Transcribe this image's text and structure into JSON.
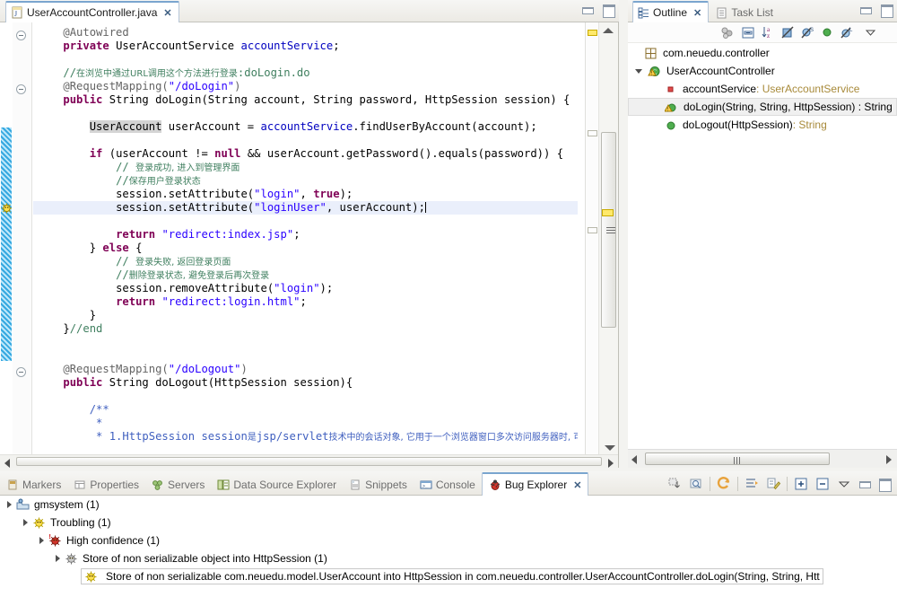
{
  "editor": {
    "tab": {
      "label": "UserAccountController.java",
      "close": "✕",
      "icon": "java-file-icon"
    },
    "window_buttons": {
      "minimize": "minimize-icon",
      "maximize": "maximize-icon"
    },
    "code_lines": [
      {
        "indent": 4,
        "tokens": [
          {
            "t": "@Autowired",
            "c": "ann"
          }
        ]
      },
      {
        "indent": 4,
        "tokens": [
          {
            "t": "private",
            "c": "kw"
          },
          {
            "t": " UserAccountService "
          },
          {
            "t": "accountService",
            "c": "fld"
          },
          {
            "t": ";"
          }
        ]
      },
      {
        "indent": 0,
        "tokens": []
      },
      {
        "indent": 4,
        "tokens": [
          {
            "t": "//",
            "c": "cmt"
          },
          {
            "t": "在浏览中通过URL调用这个方法进行登录",
            "c": "cmt cn"
          },
          {
            "t": ":doLogin.do",
            "c": "cmt"
          }
        ]
      },
      {
        "indent": 4,
        "tokens": [
          {
            "t": "@RequestMapping(",
            "c": "ann"
          },
          {
            "t": "\"/doLogin\"",
            "c": "str"
          },
          {
            "t": ")",
            "c": "ann"
          }
        ]
      },
      {
        "indent": 4,
        "tokens": [
          {
            "t": "public",
            "c": "kw"
          },
          {
            "t": " String doLogin(String account, String password, HttpSession session) {"
          }
        ]
      },
      {
        "indent": 0,
        "tokens": []
      },
      {
        "indent": 8,
        "tokens": [
          {
            "t": "UserAccount",
            "c": "sel-id"
          },
          {
            "t": " userAccount = "
          },
          {
            "t": "accountService",
            "c": "fld"
          },
          {
            "t": ".findUserByAccount(account);"
          }
        ]
      },
      {
        "indent": 0,
        "tokens": []
      },
      {
        "indent": 8,
        "tokens": [
          {
            "t": "if",
            "c": "kw"
          },
          {
            "t": " (userAccount != "
          },
          {
            "t": "null",
            "c": "kw"
          },
          {
            "t": " && userAccount.getPassword().equals(password)) {"
          }
        ]
      },
      {
        "indent": 12,
        "tokens": [
          {
            "t": "// ",
            "c": "cmt"
          },
          {
            "t": "登录成功, 进入到管理界面",
            "c": "cmt cn"
          }
        ]
      },
      {
        "indent": 12,
        "tokens": [
          {
            "t": "//",
            "c": "cmt"
          },
          {
            "t": "保存用户登录状态",
            "c": "cmt cn"
          }
        ]
      },
      {
        "indent": 12,
        "tokens": [
          {
            "t": "session.setAttribute("
          },
          {
            "t": "\"login\"",
            "c": "str"
          },
          {
            "t": ", "
          },
          {
            "t": "true",
            "c": "kw"
          },
          {
            "t": ");"
          }
        ]
      },
      {
        "indent": 12,
        "current": true,
        "tokens": [
          {
            "t": "session.setAttribute("
          },
          {
            "t": "\"loginUser\"",
            "c": "str"
          },
          {
            "t": ", userAccount);"
          },
          {
            "t": "",
            "caret": true
          }
        ]
      },
      {
        "indent": 0,
        "tokens": []
      },
      {
        "indent": 12,
        "tokens": [
          {
            "t": "return",
            "c": "kw"
          },
          {
            "t": " "
          },
          {
            "t": "\"redirect:index.jsp\"",
            "c": "str"
          },
          {
            "t": ";"
          }
        ]
      },
      {
        "indent": 8,
        "tokens": [
          {
            "t": "} "
          },
          {
            "t": "else",
            "c": "kw"
          },
          {
            "t": " {"
          }
        ]
      },
      {
        "indent": 12,
        "tokens": [
          {
            "t": "// ",
            "c": "cmt"
          },
          {
            "t": "登录失败, 返回登录页面",
            "c": "cmt cn"
          }
        ]
      },
      {
        "indent": 12,
        "tokens": [
          {
            "t": "//",
            "c": "cmt"
          },
          {
            "t": "删除登录状态, 避免登录后再次登录",
            "c": "cmt cn"
          }
        ]
      },
      {
        "indent": 12,
        "tokens": [
          {
            "t": "session.removeAttribute("
          },
          {
            "t": "\"login\"",
            "c": "str"
          },
          {
            "t": ");"
          }
        ]
      },
      {
        "indent": 12,
        "tokens": [
          {
            "t": "return",
            "c": "kw"
          },
          {
            "t": " "
          },
          {
            "t": "\"redirect:login.html\"",
            "c": "str"
          },
          {
            "t": ";"
          }
        ]
      },
      {
        "indent": 8,
        "tokens": [
          {
            "t": "}"
          }
        ]
      },
      {
        "indent": 4,
        "tokens": [
          {
            "t": "}"
          },
          {
            "t": "//end",
            "c": "cmt"
          }
        ]
      },
      {
        "indent": 0,
        "tokens": []
      },
      {
        "indent": 0,
        "tokens": []
      },
      {
        "indent": 4,
        "tokens": [
          {
            "t": "@RequestMapping(",
            "c": "ann"
          },
          {
            "t": "\"/doLogout\"",
            "c": "str"
          },
          {
            "t": ")",
            "c": "ann"
          }
        ]
      },
      {
        "indent": 4,
        "tokens": [
          {
            "t": "public",
            "c": "kw"
          },
          {
            "t": " String doLogout(HttpSession session){"
          }
        ]
      },
      {
        "indent": 0,
        "tokens": []
      },
      {
        "indent": 8,
        "tokens": [
          {
            "t": "/**",
            "c": "cmtb"
          }
        ]
      },
      {
        "indent": 9,
        "tokens": [
          {
            "t": "*",
            "c": "cmtb"
          }
        ]
      },
      {
        "indent": 9,
        "tokens": [
          {
            "t": "* 1.HttpSession session",
            "c": "cmtb"
          },
          {
            "t": "是",
            "c": "cmtb cn"
          },
          {
            "t": "jsp/servlet",
            "c": "cmtb"
          },
          {
            "t": "技术中的会话对象, 它用于一个浏览器窗口多次访问服务器时, 可以在多个页",
            "c": "cmtb cn"
          }
        ]
      }
    ]
  },
  "outline": {
    "tabs": [
      {
        "label": "Outline",
        "icon": "outline-icon",
        "active": true,
        "close": "✕"
      },
      {
        "label": "Task List",
        "icon": "tasklist-icon",
        "active": false
      }
    ],
    "toolbar_icons": [
      "sort-hide-fields-icon",
      "collapse-all-icon",
      "sort-alpha-icon",
      "hide-nonpublic-icon",
      "hide-static-icon",
      "hide-fields-icon",
      "hide-local-types-icon",
      "view-menu-icon"
    ],
    "tree": [
      {
        "depth": 0,
        "label": "com.neuedu.controller",
        "icon": "package-icon",
        "arrow": "none"
      },
      {
        "depth": 0,
        "label": "UserAccountController",
        "icon": "class-icon",
        "arrow": "open",
        "warn": true
      },
      {
        "depth": 1,
        "label": "accountService",
        "suffix": " : UserAccountService",
        "icon": "private-field-icon",
        "arrow": "none"
      },
      {
        "depth": 1,
        "label": "doLogin(String, String, HttpSession) : String",
        "icon": "public-method-icon",
        "arrow": "none",
        "selected": true,
        "warn": true
      },
      {
        "depth": 1,
        "label": "doLogout(HttpSession)",
        "suffix": " : String",
        "icon": "public-method-icon",
        "arrow": "none"
      }
    ]
  },
  "bottom": {
    "tabs": [
      {
        "label": "Markers",
        "icon": "markers-icon",
        "active": false
      },
      {
        "label": "Properties",
        "icon": "properties-icon",
        "active": false
      },
      {
        "label": "Servers",
        "icon": "servers-icon",
        "active": false
      },
      {
        "label": "Data Source Explorer",
        "icon": "datasource-icon",
        "active": false
      },
      {
        "label": "Snippets",
        "icon": "snippets-icon",
        "active": false
      },
      {
        "label": "Console",
        "icon": "console-icon",
        "active": false
      },
      {
        "label": "Bug Explorer",
        "icon": "bug-icon",
        "active": true,
        "close": "✕"
      }
    ],
    "toolbar_icons": [
      "save-bugs-icon",
      "load-bugs-icon",
      "refresh-icon",
      "sort-filter-icon",
      "configure-icon",
      "expand-all-icon",
      "collapse-all-icon",
      "view-menu-icon",
      "minimize-icon",
      "maximize-icon"
    ],
    "tree": [
      {
        "depth": 0,
        "label": "gmsystem (1)",
        "icon": "project-icon",
        "arrow": "open"
      },
      {
        "depth": 1,
        "label": "Troubling (1)",
        "icon": "bug-yellow-icon",
        "arrow": "open"
      },
      {
        "depth": 2,
        "label": "High confidence (1)",
        "icon": "bug-red-icon",
        "arrow": "open"
      },
      {
        "depth": 3,
        "label": "Store of non serializable object into HttpSession (1)",
        "icon": "bug-gray-icon",
        "arrow": "open"
      },
      {
        "depth": 4,
        "label": "Store of non serializable com.neuedu.model.UserAccount into HttpSession in com.neuedu.controller.UserAccountController.doLogin(String, String, Htt",
        "icon": "bug-yellow-icon",
        "arrow": "none",
        "selected": true
      }
    ]
  },
  "colors": {
    "keyword": "#7f0055",
    "string": "#2a00ff",
    "comment": "#3f7f5f",
    "javadoc": "#3f5fbf",
    "field": "#0000c0",
    "tab_accent": "#7aa5cf",
    "change_bar": "#35a8e0"
  }
}
